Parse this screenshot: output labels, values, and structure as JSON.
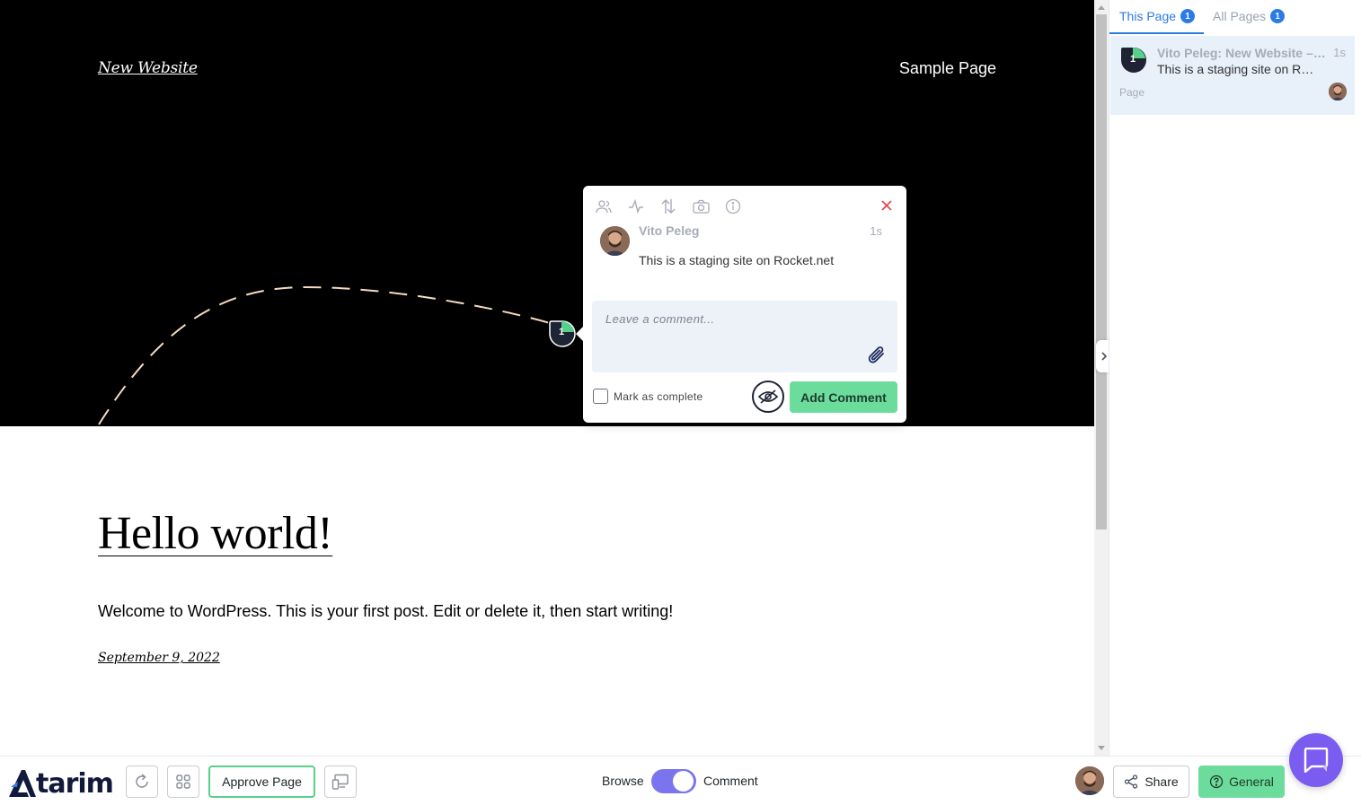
{
  "site": {
    "title": "New Website",
    "nav_link": "Sample Page",
    "post_title": "Hello world!",
    "post_body": "Welcome to WordPress. This is your first post. Edit or delete it, then start writing!",
    "post_date": "September 9, 2022",
    "pin_number": "1"
  },
  "popup": {
    "tools": [
      "users-icon",
      "activity-icon",
      "arrows-up-down-icon",
      "camera-icon",
      "info-icon"
    ],
    "author": "Vito Peleg",
    "time": "1s",
    "message": "This is a staging site on Rocket.net",
    "input_placeholder": "Leave a comment...",
    "input_value": "",
    "mark_complete_label": "Mark as complete",
    "mark_complete_checked": false,
    "add_comment_label": "Add Comment"
  },
  "sidebar": {
    "tabs": [
      {
        "label": "This Page",
        "count": "1",
        "active": true
      },
      {
        "label": "All Pages",
        "count": "1",
        "active": false
      }
    ],
    "comments": [
      {
        "number": "1",
        "title": "Vito Peleg: New Website – Sample Page",
        "time": "1s",
        "message": "This is a staging site on Rocket.net",
        "type": "Page"
      }
    ]
  },
  "toolbar": {
    "logo_text": "tarim",
    "approve_label": "Approve Page",
    "browse_label": "Browse",
    "comment_label": "Comment",
    "mode": "Comment",
    "share_label": "Share",
    "general_label": "General"
  },
  "colors": {
    "accent_green": "#6cdc9c",
    "accent_blue": "#2c7be5",
    "toggle_purple": "#7b74ef",
    "chat_purple": "#7b5cf0",
    "pin_dark": "#1e2433",
    "dash_color": "#f5dcc0"
  }
}
